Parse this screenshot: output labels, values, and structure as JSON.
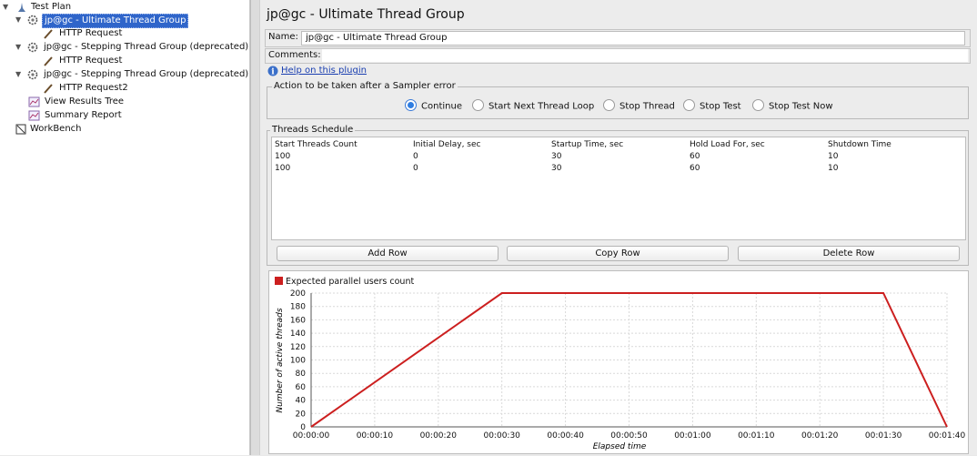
{
  "tree": {
    "items": [
      {
        "label": "Test Plan",
        "icon": "test-plan-icon"
      },
      {
        "label": "jp@gc - Ultimate Thread Group",
        "icon": "thread-group-gear-icon",
        "selected": true
      },
      {
        "label": "HTTP Request",
        "icon": "sampler-pipette-icon"
      },
      {
        "label": "jp@gc - Stepping Thread Group (deprecated)",
        "icon": "thread-group-gear-icon"
      },
      {
        "label": "HTTP Request",
        "icon": "sampler-pipette-icon"
      },
      {
        "label": "jp@gc - Stepping Thread Group (deprecated)",
        "icon": "thread-group-gear-icon"
      },
      {
        "label": "HTTP Request2",
        "icon": "sampler-pipette-icon"
      },
      {
        "label": "View Results Tree",
        "icon": "listener-chart-icon"
      },
      {
        "label": "Summary Report",
        "icon": "listener-chart-icon"
      },
      {
        "label": "WorkBench",
        "icon": "workbench-icon"
      }
    ]
  },
  "panel": {
    "title": "jp@gc - Ultimate Thread Group",
    "name_label": "Name:",
    "name_value": "jp@gc - Ultimate Thread Group",
    "comments_label": "Comments:",
    "help_link": "Help on this plugin",
    "sampler_error": {
      "legend": "Action to be taken after a Sampler error",
      "options": [
        "Continue",
        "Start Next Thread Loop",
        "Stop Thread",
        "Stop Test",
        "Stop Test Now"
      ],
      "selected": "Continue"
    },
    "schedule": {
      "legend": "Threads Schedule",
      "columns": [
        "Start Threads Count",
        "Initial Delay, sec",
        "Startup Time, sec",
        "Hold Load For, sec",
        "Shutdown Time"
      ],
      "rows": [
        [
          "100",
          "0",
          "30",
          "60",
          "10"
        ],
        [
          "100",
          "0",
          "30",
          "60",
          "10"
        ]
      ],
      "buttons": [
        "Add Row",
        "Copy Row",
        "Delete Row"
      ]
    }
  },
  "chart_data": {
    "type": "line",
    "series": [
      {
        "name": "Expected parallel users count",
        "color": "#cc1f1f",
        "x": [
          "00:00:00",
          "00:00:30",
          "00:01:30",
          "00:01:40"
        ],
        "y": [
          0,
          200,
          200,
          0
        ]
      }
    ],
    "x_ticks": [
      "00:00:00",
      "00:00:10",
      "00:00:20",
      "00:00:30",
      "00:00:40",
      "00:00:50",
      "00:01:00",
      "00:01:10",
      "00:01:20",
      "00:01:30",
      "00:01:40"
    ],
    "y_ticks": [
      "0",
      "20",
      "40",
      "60",
      "80",
      "100",
      "120",
      "140",
      "160",
      "180",
      "200"
    ],
    "xlabel": "Elapsed time",
    "ylabel": "Number of active threads",
    "ylim": [
      0,
      200
    ],
    "xlim": [
      "00:00:00",
      "00:01:40"
    ],
    "grid": true,
    "legend_position": "top-left"
  }
}
